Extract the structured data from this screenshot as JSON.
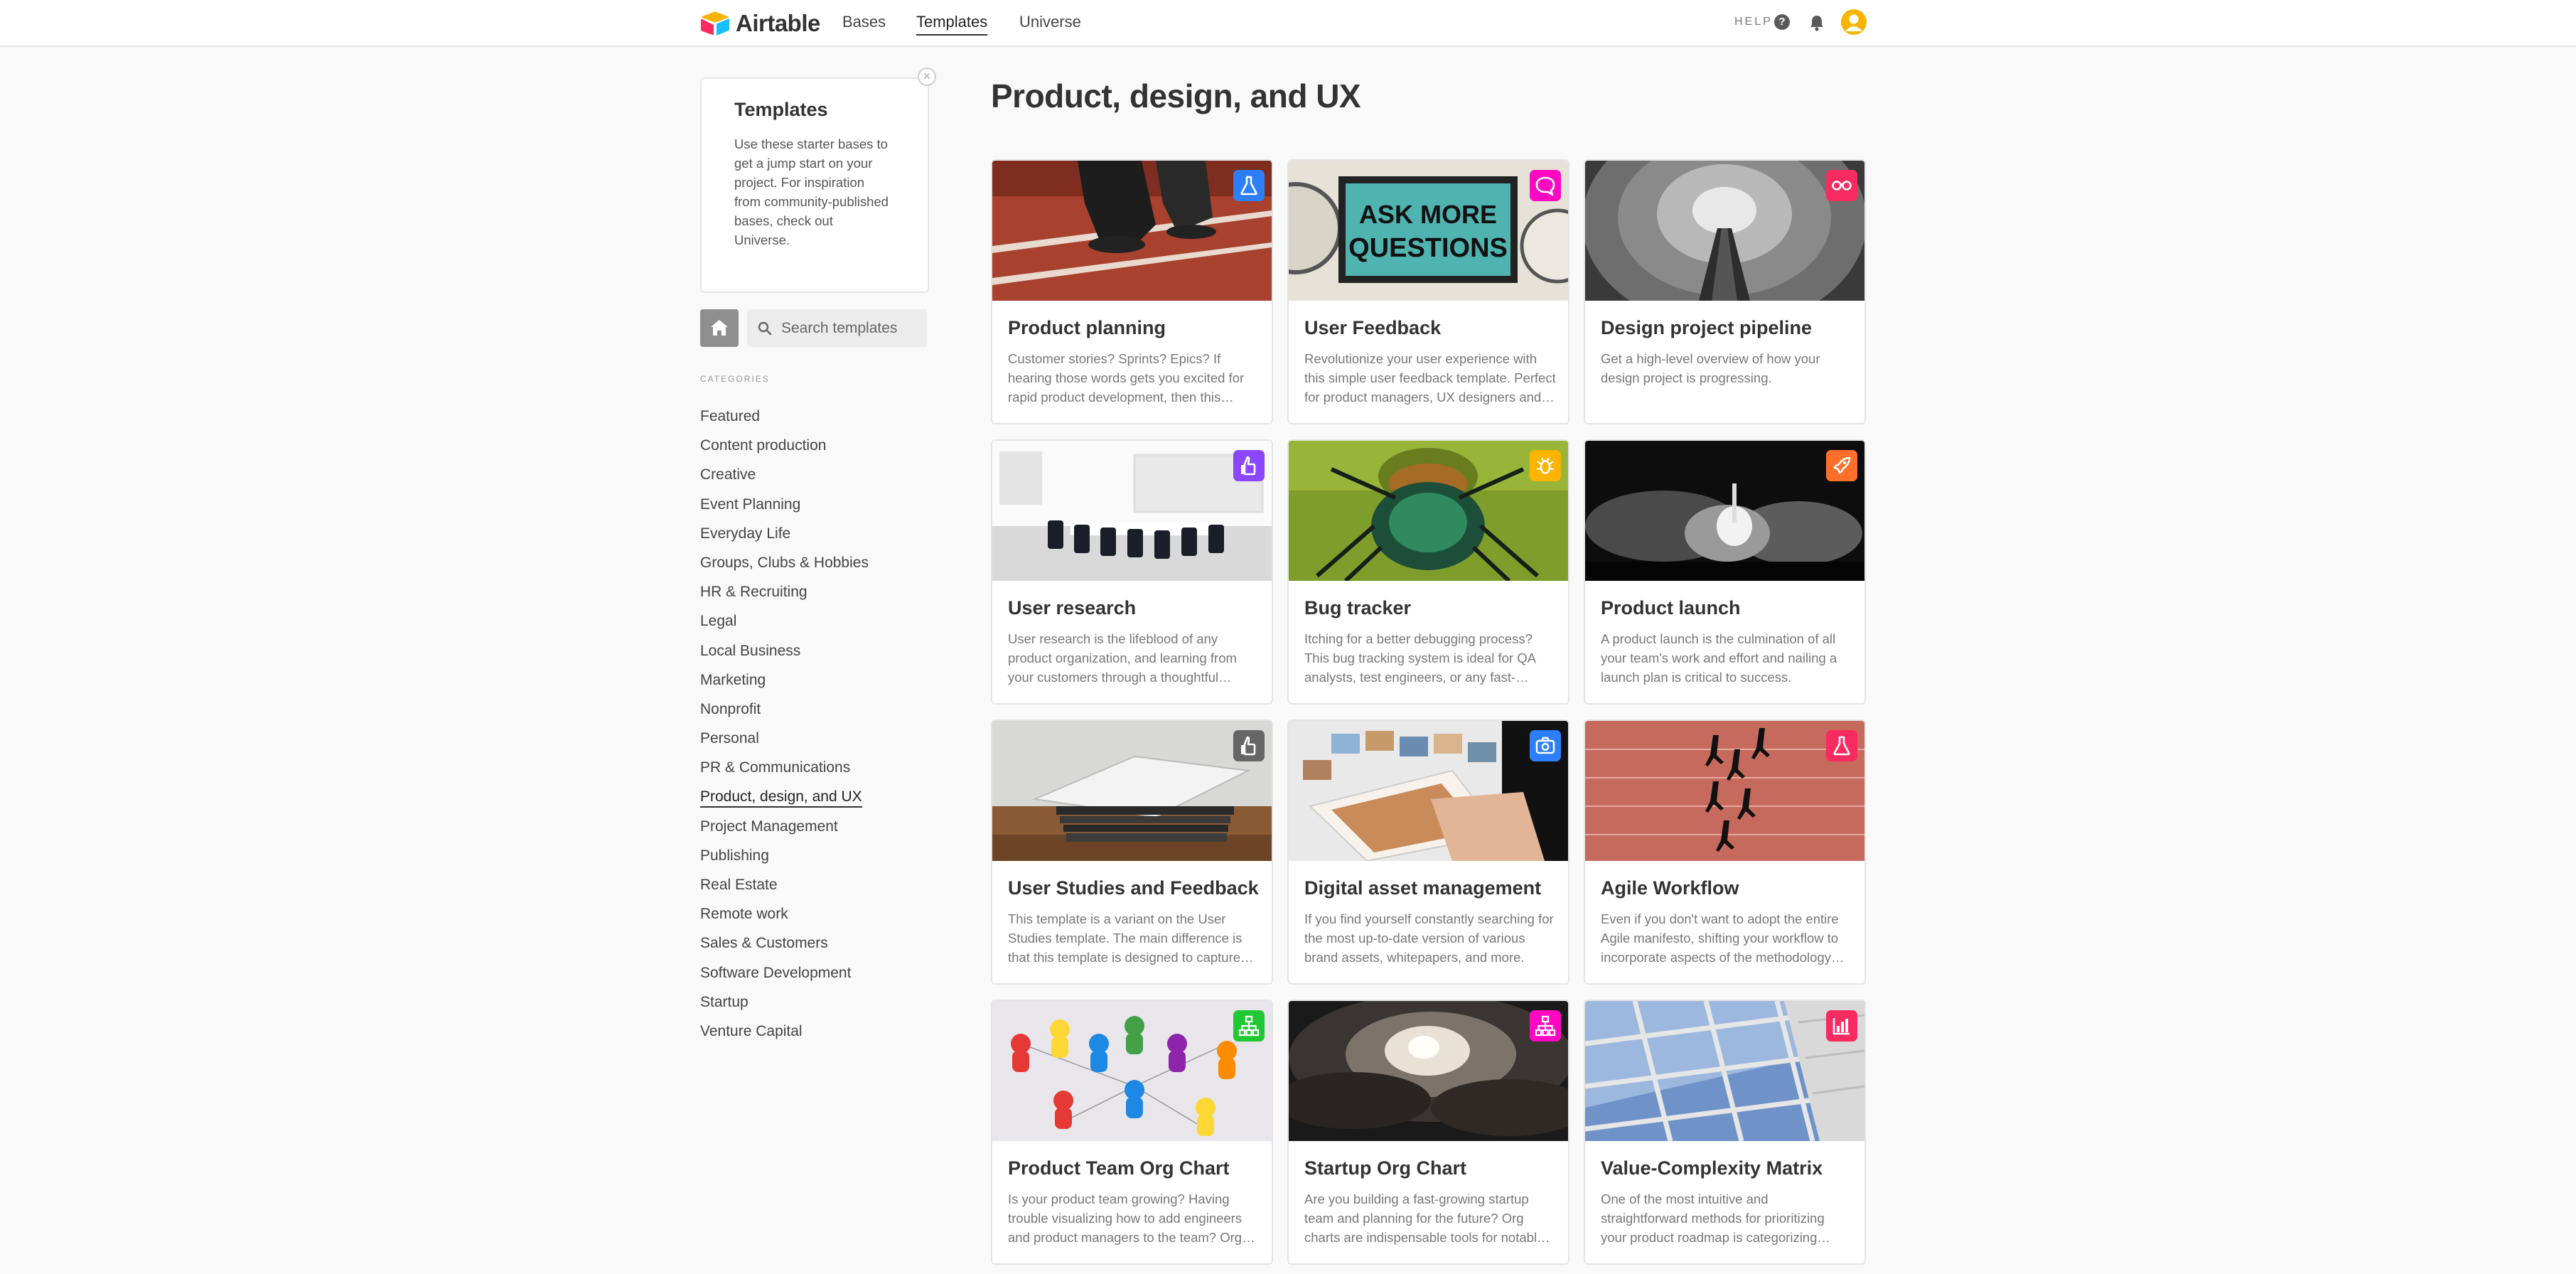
{
  "nav": {
    "brand": "Airtable",
    "links": [
      "Bases",
      "Templates",
      "Universe"
    ],
    "active": "Templates",
    "help_label": "HELP",
    "icons": [
      "help-icon",
      "bell-icon",
      "avatar"
    ]
  },
  "sidebar": {
    "intro_title": "Templates",
    "intro_text": "Use these starter bases to get a jump start on your project. For inspiration from community-published bases, check out Universe.",
    "search_placeholder": "Search templates",
    "categories_header": "CATEGORIES",
    "categories": [
      "Featured",
      "Content production",
      "Creative",
      "Event Planning",
      "Everyday Life",
      "Groups, Clubs & Hobbies",
      "HR & Recruiting",
      "Legal",
      "Local Business",
      "Marketing",
      "Nonprofit",
      "Personal",
      "PR & Communications",
      "Product, design, and UX",
      "Project Management",
      "Publishing",
      "Real Estate",
      "Remote work",
      "Sales & Customers",
      "Software Development",
      "Startup",
      "Venture Capital"
    ],
    "active_category": "Product, design, and UX"
  },
  "main": {
    "title": "Product, design, and UX",
    "cards": [
      {
        "title": "Product planning",
        "desc": "Customer stories? Sprints? Epics? If hearing those words gets you excited for rapid product development, then this template is for you.",
        "badge_color": "#2d7ff9",
        "badge_icon": "flask-icon"
      },
      {
        "title": "User Feedback",
        "desc": "Revolutionize your user experience with this simple user feedback template. Perfect for product managers, UX designers and more.",
        "badge_color": "#ff08c2",
        "badge_icon": "chat-icon"
      },
      {
        "title": "Design project pipeline",
        "desc": "Get a high-level overview of how your design project is progressing.",
        "badge_color": "#f82b60",
        "badge_icon": "glasses-icon"
      },
      {
        "title": "User research",
        "desc": "User research is the lifeblood of any product organization, and learning from your customers through a thoughtful process is key.",
        "badge_color": "#8b46ff",
        "badge_icon": "hand-icon"
      },
      {
        "title": "Bug tracker",
        "desc": "Itching for a better debugging process? This bug tracking system is ideal for QA analysts, test engineers, or any fast-moving team.",
        "badge_color": "#fcb400",
        "badge_icon": "bug-icon"
      },
      {
        "title": "Product launch",
        "desc": "A product launch is the culmination of all your team's work and effort and nailing a launch plan is critical to success.",
        "badge_color": "#ff6f2c",
        "badge_icon": "rocket-icon"
      },
      {
        "title": "User Studies and Feedback",
        "desc": "This template is a variant on the User Studies template. The main difference is that this template is designed to capture feedback.",
        "badge_color": "#666666",
        "badge_icon": "hand-icon"
      },
      {
        "title": "Digital asset management",
        "desc": "If you find yourself constantly searching for the most up-to-date version of various brand assets, whitepapers, and more.",
        "badge_color": "#2d7ff9",
        "badge_icon": "camera-icon"
      },
      {
        "title": "Agile Workflow",
        "desc": "Even if you don't want to adopt the entire Agile manifesto, shifting your workflow to incorporate aspects of the methodology helps.",
        "badge_color": "#f82b60",
        "badge_icon": "flask-icon"
      },
      {
        "title": "Product Team Org Chart",
        "desc": "Is your product team growing? Having trouble visualizing how to add engineers and product managers to the team? Org charts help.",
        "badge_color": "#20c933",
        "badge_icon": "org-chart-icon"
      },
      {
        "title": "Startup Org Chart",
        "desc": "Are you building a fast-growing startup team and planning for the future? Org charts are indispensable tools for notable growth.",
        "badge_color": "#ff08c2",
        "badge_icon": "org-chart-icon"
      },
      {
        "title": "Value-Complexity Matrix",
        "desc": "One of the most intuitive and straightforward methods for prioritizing your product roadmap is categorizing features.",
        "badge_color": "#f82b60",
        "badge_icon": "bar-chart-icon"
      }
    ]
  }
}
